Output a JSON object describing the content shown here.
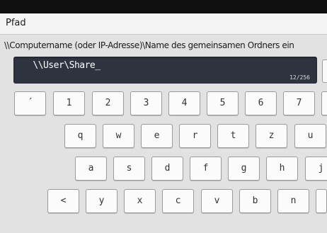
{
  "window": {
    "title": "Pfad"
  },
  "path_label": "\\\\Computername (oder IP-Adresse)\\Name des gemeinsamen Ordners ein",
  "input": {
    "value": " \\\\User\\Share_",
    "char_count": "12/256"
  },
  "keyboard": {
    "row1": [
      "´",
      "1",
      "2",
      "3",
      "4",
      "5",
      "6",
      "7",
      ""
    ],
    "row2": [
      "q",
      "w",
      "e",
      "r",
      "t",
      "z",
      "u"
    ],
    "row3": [
      "a",
      "s",
      "d",
      "f",
      "g",
      "h",
      "j"
    ],
    "row4": [
      "<",
      "y",
      "x",
      "c",
      "v",
      "b",
      "n",
      ""
    ]
  }
}
